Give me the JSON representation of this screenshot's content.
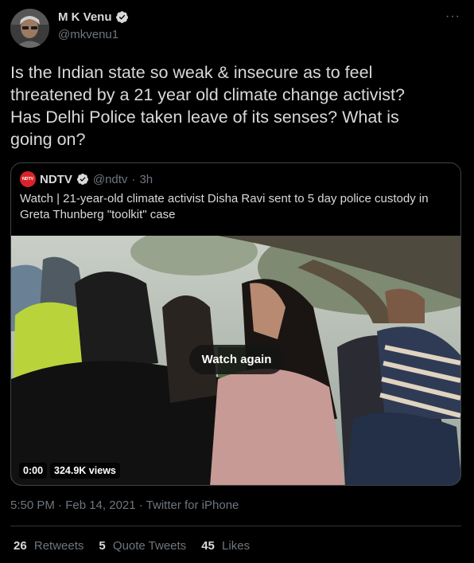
{
  "author": {
    "name": "M K Venu",
    "handle": "@mkvenu1"
  },
  "tweet": {
    "text": "Is the Indian state so weak & insecure as to feel\nthreatened by a 21 year old climate change activist?\nHas Delhi Police taken leave of its senses? What is\ngoing on?"
  },
  "quote": {
    "logo_text": "NDTV",
    "name": "NDTV",
    "handle": "@ndtv",
    "time": "3h",
    "text": "Watch | 21-year-old climate activist Disha Ravi sent to 5 day police custody in Greta Thunberg \"toolkit\" case",
    "video": {
      "watch_again_label": "Watch again",
      "duration": "0:00",
      "views": "324.9K views"
    }
  },
  "meta": {
    "timestamp": "5:50 PM · Feb 14, 2021 · Twitter for iPhone"
  },
  "stats": {
    "retweets_count": "26",
    "retweets_label": "Retweets",
    "quotes_count": "5",
    "quotes_label": "Quote Tweets",
    "likes_count": "45",
    "likes_label": "Likes"
  },
  "icons": {
    "verified": "verified-badge-icon",
    "more": "more-options-icon",
    "accent_verified": "#1da1f2"
  }
}
